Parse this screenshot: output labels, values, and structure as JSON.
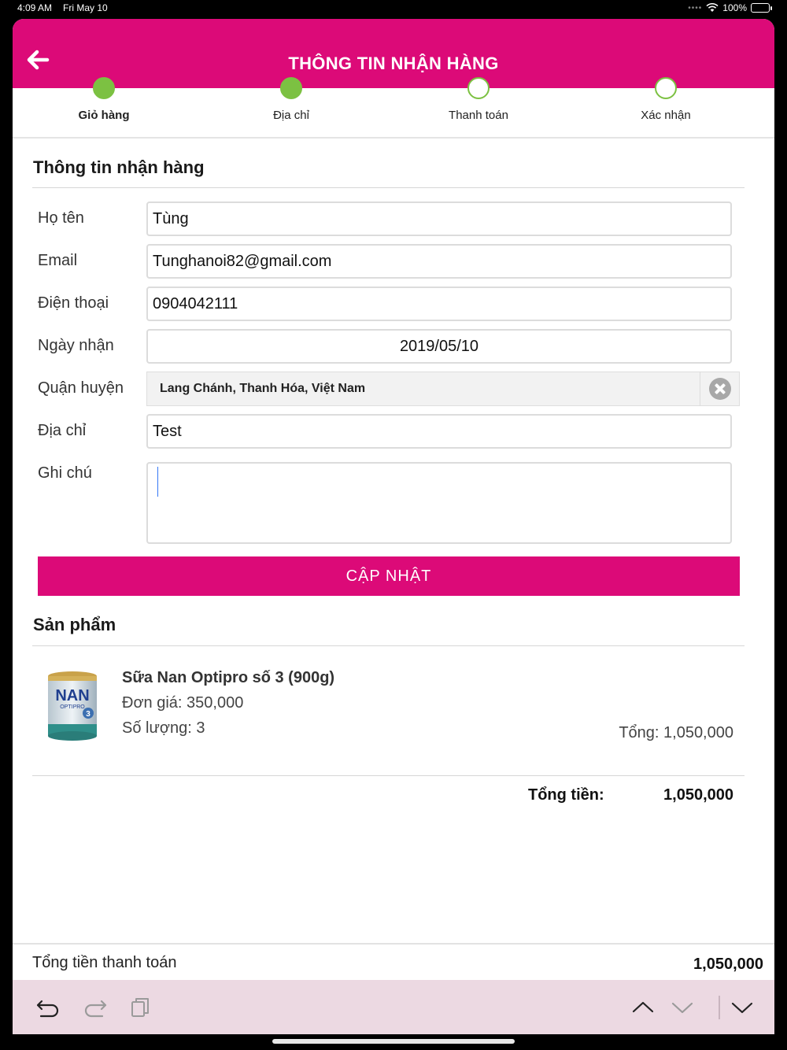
{
  "status_bar": {
    "time": "4:09 AM",
    "date": "Fri May 10",
    "battery": "100%"
  },
  "header": {
    "title": "THÔNG TIN NHẬN HÀNG",
    "back_icon": "arrow-left-icon"
  },
  "steps": [
    {
      "label": "Giỏ hàng",
      "state": "done"
    },
    {
      "label": "Địa chỉ",
      "state": "done"
    },
    {
      "label": "Thanh toán",
      "state": "pending"
    },
    {
      "label": "Xác nhận",
      "state": "pending"
    }
  ],
  "form": {
    "title": "Thông tin nhận hàng",
    "name_label": "Họ tên",
    "name_value": "Tùng",
    "email_label": "Email",
    "email_value": "Tunghanoi82@gmail.com",
    "phone_label": "Điện thoại",
    "phone_value": "0904042111",
    "date_label": "Ngày nhận",
    "date_value": "2019/05/10",
    "district_label": "Quận huyện",
    "district_value": "Lang Chánh, Thanh Hóa, Việt Nam",
    "address_label": "Địa chỉ",
    "address_value": "Test",
    "note_label": "Ghi chú",
    "note_value": "",
    "update_label": "CẬP NHẬT"
  },
  "products": {
    "title": "Sản phẩm",
    "items": [
      {
        "name": "Sữa Nan Optipro số 3 (900g)",
        "price": "Đơn giá: 350,000",
        "quantity": "Số lượng: 3",
        "total": "Tổng: 1,050,000"
      }
    ],
    "image_brand": "NAN",
    "image_sub": "OPTIPRO",
    "image_num": "3"
  },
  "summary": {
    "label": "Tổng tiền:",
    "value": "1,050,000"
  },
  "payment": {
    "label": "Tổng tiền thanh toán",
    "value": "1,050,000"
  },
  "keyboard_toolbar": {
    "icons": [
      "undo-icon",
      "redo-icon",
      "paste-icon",
      "chevron-up-icon",
      "chevron-down-icon",
      "dismiss-keyboard-icon"
    ]
  },
  "colors": {
    "brand": "#dc0a78",
    "step_done": "#7cc142",
    "toolbar": "#ecd9e2"
  }
}
